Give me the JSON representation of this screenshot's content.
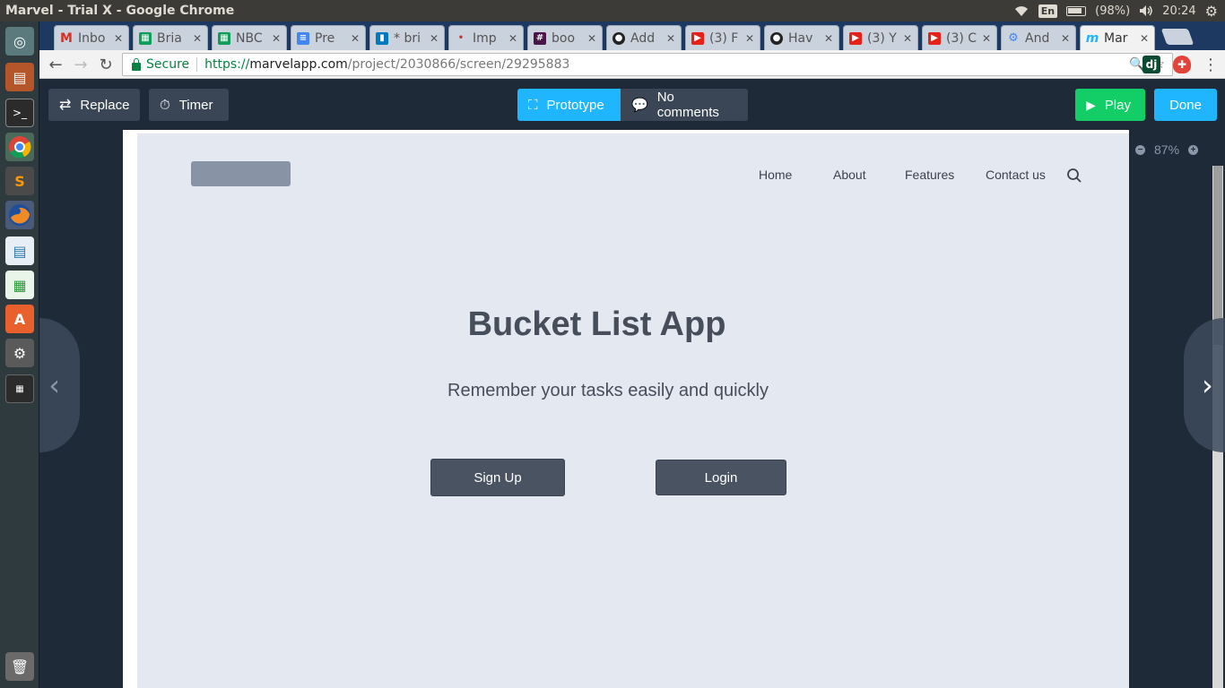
{
  "os_bar": {
    "window_title": "Marvel - Trial X - Google Chrome",
    "keyboard": "En",
    "battery": "(98%)",
    "time": "20:24"
  },
  "tabs": [
    {
      "label": "Inbo",
      "icon": "gmail-icon",
      "color": "#d93025"
    },
    {
      "label": "Bria",
      "icon": "sheets-icon",
      "color": "#0f9d58"
    },
    {
      "label": "NBC",
      "icon": "sheets-icon",
      "color": "#0f9d58"
    },
    {
      "label": "Pre",
      "icon": "docs-icon",
      "color": "#4285f4"
    },
    {
      "label": "* bri",
      "icon": "trello-icon",
      "color": "#0079bf"
    },
    {
      "label": "Imp",
      "icon": "generic-page-icon",
      "color": "#c0392b"
    },
    {
      "label": "boo",
      "icon": "slack-icon",
      "color": "#4a154b"
    },
    {
      "label": "Add",
      "icon": "github-icon",
      "color": "#222222"
    },
    {
      "label": "(3) F",
      "icon": "youtube-icon",
      "color": "#e62117"
    },
    {
      "label": "Hav",
      "icon": "github-icon",
      "color": "#222222"
    },
    {
      "label": "(3) Y",
      "icon": "youtube-icon",
      "color": "#e62117"
    },
    {
      "label": "(3) C",
      "icon": "youtube-icon",
      "color": "#e62117"
    },
    {
      "label": "And",
      "icon": "settings-cog-icon",
      "color": "#4285f4"
    },
    {
      "label": "Mar",
      "icon": "marvel-icon",
      "color": "#1fb6ff"
    }
  ],
  "address": {
    "secure_label": "Secure",
    "scheme": "https://",
    "host": "marvelapp.com",
    "path": "/project/2030866/screen/29295883"
  },
  "marvel_toolbar": {
    "replace": "Replace",
    "timer": "Timer",
    "prototype": "Prototype",
    "comments": "No comments",
    "play": "Play",
    "done": "Done"
  },
  "zoom": "87%",
  "prototype_screen": {
    "nav": [
      "Home",
      "About",
      "Features",
      "Contact us"
    ],
    "title": "Bucket List App",
    "subtitle": "Remember your tasks easily and quickly",
    "signup": "Sign Up",
    "login": "Login"
  },
  "colors": {
    "marvel_bg": "#1e2a38",
    "marvel_blue": "#1fb6ff",
    "marvel_green": "#13ce66",
    "screen_bg": "#e4e8f0",
    "button_dark": "#4a5361"
  }
}
